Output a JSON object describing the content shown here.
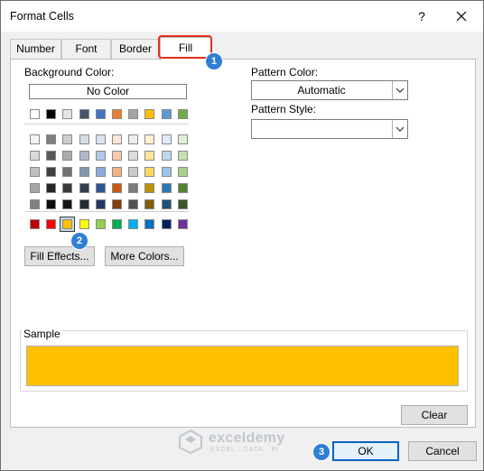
{
  "dialog": {
    "title": "Format Cells",
    "help_glyph": "?",
    "close_glyph": "✕"
  },
  "tabs": [
    {
      "label": "Number"
    },
    {
      "label": "Font"
    },
    {
      "label": "Border"
    },
    {
      "label": "Fill",
      "active": true
    }
  ],
  "fill": {
    "background_color_label": "Background Color:",
    "no_color_label": "No Color",
    "theme_row": [
      "#ffffff",
      "#000000",
      "#e7e6e6",
      "#44546a",
      "#4472c4",
      "#ed7d31",
      "#a5a5a5",
      "#ffc000",
      "#5b9bd5",
      "#70ad47"
    ],
    "tint_rows": [
      [
        "#f2f2f2",
        "#7f7f7f",
        "#d0cece",
        "#d6dce5",
        "#dae3f3",
        "#fbe5d6",
        "#ededed",
        "#fff2cc",
        "#deebf7",
        "#e2f0d9"
      ],
      [
        "#d9d9d9",
        "#595959",
        "#aeabab",
        "#adb9ca",
        "#b4c7e7",
        "#f8cbad",
        "#dbdbdb",
        "#ffe699",
        "#bdd7ee",
        "#c5e0b4"
      ],
      [
        "#bfbfbf",
        "#404040",
        "#757171",
        "#8497b0",
        "#8faadc",
        "#f4b183",
        "#c9c9c9",
        "#ffd966",
        "#9dc3e6",
        "#a9d18e"
      ],
      [
        "#a6a6a6",
        "#262626",
        "#3a3838",
        "#333f50",
        "#2f5597",
        "#c55a11",
        "#7b7b7b",
        "#bf9000",
        "#2e75b6",
        "#548235"
      ],
      [
        "#808080",
        "#0d0d0d",
        "#171717",
        "#222a35",
        "#203864",
        "#843c0c",
        "#525252",
        "#7f6000",
        "#1f4e79",
        "#385723"
      ]
    ],
    "standard_row": [
      "#c00000",
      "#ff0000",
      "#ffc000",
      "#ffff00",
      "#92d050",
      "#00b050",
      "#00b0f0",
      "#0070c0",
      "#002060",
      "#7030a0"
    ],
    "selected_index": 2,
    "fill_effects_label": "Fill Effects...",
    "more_colors_label": "More Colors...",
    "pattern_color_label": "Pattern Color:",
    "pattern_color_value": "Automatic",
    "pattern_style_label": "Pattern Style:",
    "pattern_style_value": "",
    "sample_label": "Sample",
    "sample_color": "#ffc000",
    "clear_label": "Clear"
  },
  "footer": {
    "ok_label": "OK",
    "cancel_label": "Cancel"
  },
  "annotations": [
    {
      "number": "1"
    },
    {
      "number": "2"
    },
    {
      "number": "3"
    }
  ],
  "watermark": {
    "name": "exceldemy",
    "tagline": "EXCEL · DATA · BI"
  },
  "colors": {
    "highlight": "#e0301e",
    "badge": "#2f7fd6",
    "ok_border": "#0a64c8"
  }
}
